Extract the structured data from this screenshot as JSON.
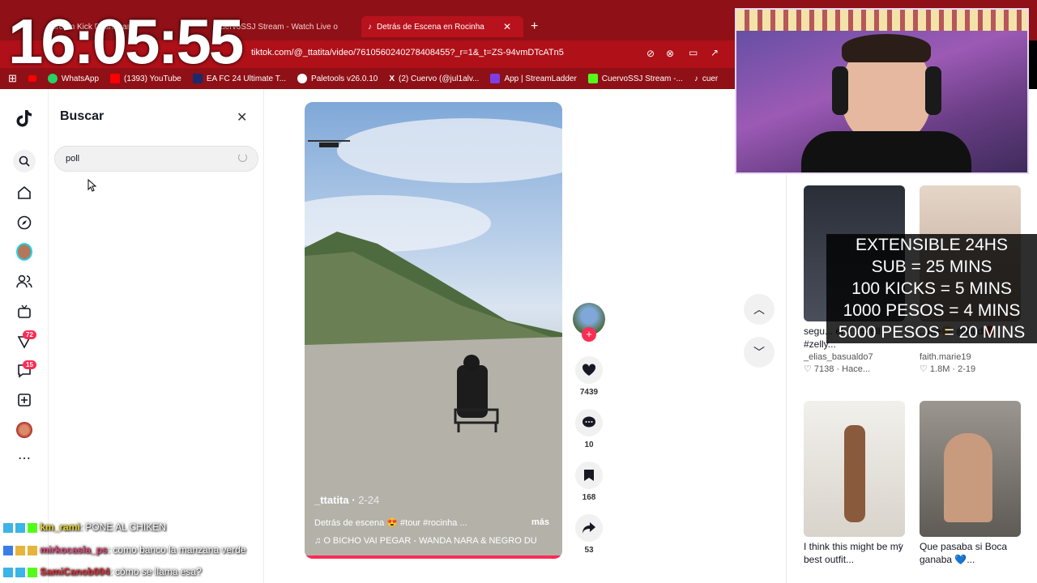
{
  "clock": "16:05:55",
  "browser": {
    "tabs": [
      {
        "label": "Stream Kick Dashboard"
      },
      {
        "label": "CuervoSSJ Stream - Watch Live o"
      },
      {
        "label": "Detrás de Escena en Rocinha"
      }
    ],
    "url": "tiktok.com/@_ttatita/video/7610560240278408455?_r=1&_t=ZS-94vmDTcATn5",
    "bookmarks": [
      {
        "label": "WhatsApp",
        "color": "#25d366"
      },
      {
        "label": "(1393) YouTube",
        "color": "#ff0000"
      },
      {
        "label": "EA FC 24 Ultimate T...",
        "color": "#1b2a6b"
      },
      {
        "label": "Paletools v26.0.10",
        "color": "#ffffff"
      },
      {
        "label": "(2) Cuervo (@jul1alv...",
        "color": "#000000"
      },
      {
        "label": "App | StreamLadder",
        "color": "#7b3fe4"
      },
      {
        "label": "CuervoSSJ Stream -...",
        "color": "#53fc18"
      },
      {
        "label": "cuer",
        "color": "#000000"
      }
    ]
  },
  "nav": {
    "items": [
      "tiktok-logo-icon",
      "search-icon",
      "home-icon",
      "explore-icon",
      "live-profile-icon",
      "following-icon",
      "live-icon",
      "activity-icon",
      "messages-icon",
      "upload-icon",
      "profile-avatar",
      "more-icon"
    ],
    "activity_badge": "72",
    "messages_badge": "15"
  },
  "search": {
    "title": "Buscar",
    "value": "poll"
  },
  "video": {
    "author": "_ttatita",
    "date": "2-24",
    "description": "Detrás de escena 😍 #tour #rocinha ...",
    "more": "más",
    "music": "O BICHO VAI PEGAR - WANDA NARA & NEGRO DU"
  },
  "actions": {
    "likes": "7439",
    "comments": "10",
    "saves": "168",
    "shares": "53"
  },
  "cards": [
    {
      "title": "segu... el + ) #zell #zelly...",
      "user": "_elias_basualdo7",
      "meta": "♡ 7138 · Hace...",
      "thumb": "#3b3f4a"
    },
    {
      "title": "...me😊 @Bud🔴",
      "user": "faith.marie19",
      "meta": "♡ 1.8M · 2-19",
      "thumb": "#d9c7b8"
    },
    {
      "title": "I think this might be my best outfit...",
      "user": "",
      "meta": "",
      "thumb": "#e9e6e1"
    },
    {
      "title": "Que pasaba si Boca ganaba 💙...",
      "user": "",
      "meta": "",
      "thumb": "#8f8b85"
    }
  ],
  "extensible": [
    "EXTENSIBLE 24HS",
    "SUB = 25 MINS",
    "100 KICKS = 5 MINS",
    "1000 PESOS = 4 MINS",
    "5000 PESOS = 20 MINS"
  ],
  "chat": [
    {
      "user": "km_rami",
      "message": ": PONE AL CHIKEN"
    },
    {
      "user": "mirkocasla_ps",
      "message": ": como banco la manzana verde"
    },
    {
      "user": "SamiCanob004",
      "message": ": cómo se llama esa?"
    }
  ]
}
